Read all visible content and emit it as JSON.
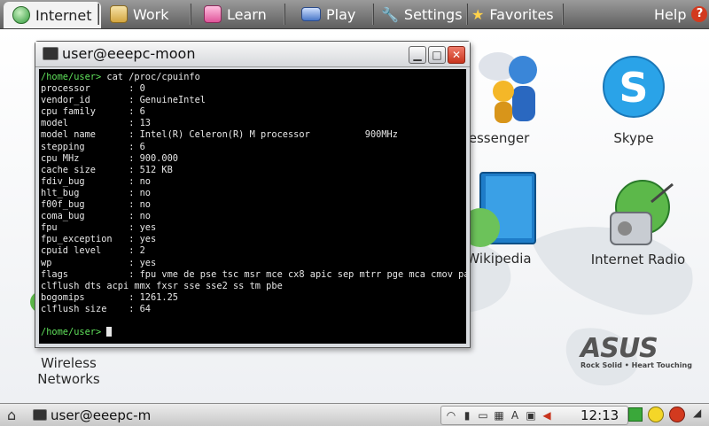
{
  "topbar": {
    "tabs": [
      {
        "label": "Internet",
        "icon": "globe-icon"
      },
      {
        "label": "Work",
        "icon": "briefcase-icon"
      },
      {
        "label": "Learn",
        "icon": "book-icon"
      },
      {
        "label": "Play",
        "icon": "gamepad-icon"
      },
      {
        "label": "Settings",
        "icon": "wrench-icon"
      },
      {
        "label": "Favorites",
        "icon": "star-icon"
      }
    ],
    "help_label": "Help",
    "help_glyph": "?"
  },
  "desktop": {
    "icons": [
      {
        "label": "essenger",
        "icon": "messenger-icon"
      },
      {
        "label": "Skype",
        "icon": "skype-icon"
      },
      {
        "label": "Wikipedia",
        "icon": "wikipedia-icon"
      },
      {
        "label": "Internet Radio",
        "icon": "radio-icon"
      },
      {
        "label": "Wireless\nNetworks",
        "icon": "wireless-icon"
      }
    ],
    "brand": {
      "name": "ASUS",
      "tagline": "Rock Solid • Heart Touching"
    }
  },
  "terminal": {
    "title": "user@eeepc-moon",
    "prompt": "/home/user>",
    "command": " cat /proc/cpuinfo",
    "output": "processor       : 0\nvendor_id       : GenuineIntel\ncpu family      : 6\nmodel           : 13\nmodel name      : Intel(R) Celeron(R) M processor          900MHz\nstepping        : 6\ncpu MHz         : 900.000\ncache size      : 512 KB\nfdiv_bug        : no\nhlt_bug         : no\nf00f_bug        : no\ncoma_bug        : no\nfpu             : yes\nfpu_exception   : yes\ncpuid level     : 2\nwp              : yes\nflags           : fpu vme de pse tsc msr mce cx8 apic sep mtrr pge mca cmov pat\nclflush dts acpi mmx fxsr sse sse2 ss tm pbe\nbogomips        : 1261.25\nclflush size    : 64\n",
    "prompt2": "/home/user>"
  },
  "taskbar": {
    "task_label": "user@eeepc-m",
    "clock": "12:13"
  },
  "colors": {
    "prompt_green": "#5fe05a",
    "terminal_bg": "#000000",
    "close_red": "#c8341d"
  }
}
